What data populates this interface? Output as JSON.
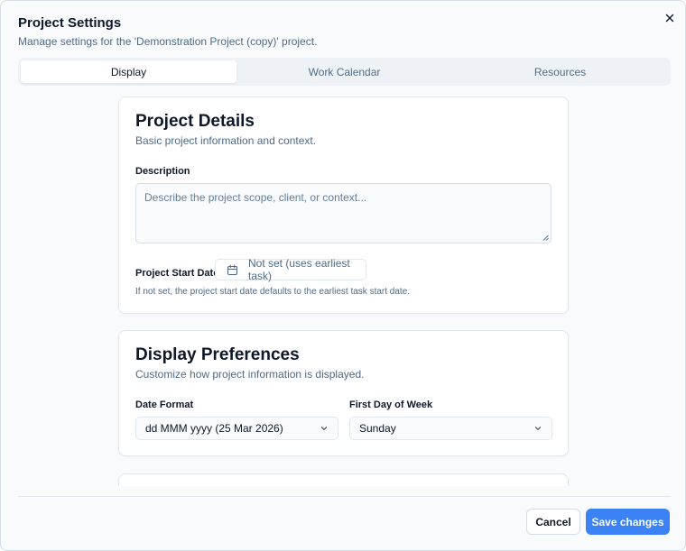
{
  "dialog": {
    "title": "Project Settings",
    "subtitle": "Manage settings for the 'Demonstration Project (copy)' project."
  },
  "tabs": [
    {
      "label": "Display",
      "active": true
    },
    {
      "label": "Work Calendar",
      "active": false
    },
    {
      "label": "Resources",
      "active": false
    }
  ],
  "project_details": {
    "title": "Project Details",
    "description": "Basic project information and context.",
    "description_label": "Description",
    "description_placeholder": "Describe the project scope, client, or context...",
    "description_value": "",
    "start_date_label": "Project Start Date",
    "start_date_value": "Not set (uses earliest task)",
    "start_date_help": "If not set, the project start date defaults to the earliest task start date."
  },
  "display_preferences": {
    "title": "Display Preferences",
    "description": "Customize how project information is displayed.",
    "date_format_label": "Date Format",
    "date_format_value": "dd MMM yyyy (25 Mar 2026)",
    "first_day_label": "First Day of Week",
    "first_day_value": "Sunday"
  },
  "footer": {
    "cancel_label": "Cancel",
    "save_label": "Save changes"
  },
  "icons": {
    "close": "close-icon",
    "calendar": "calendar-icon",
    "chevron": "chevron-down-icon"
  },
  "colors": {
    "accent": "#3b82f6",
    "muted_text": "#4f6a86",
    "border": "#e2e8f0"
  }
}
